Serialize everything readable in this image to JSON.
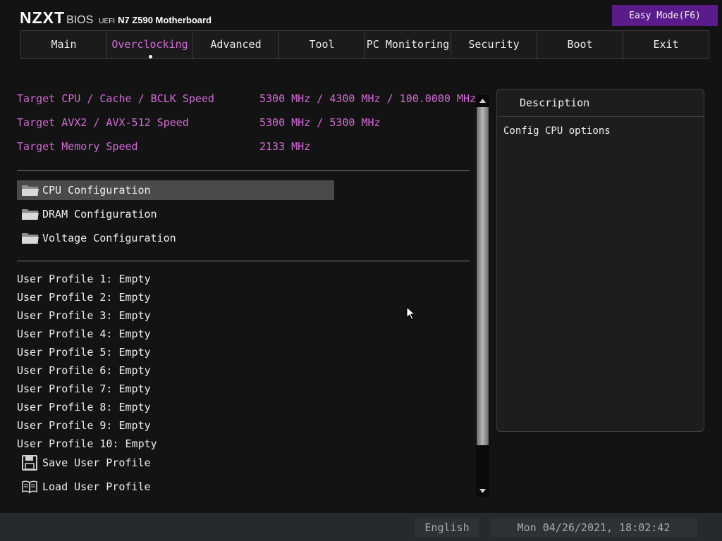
{
  "header": {
    "brand": "NZXT",
    "bios": "BIOS",
    "uefi": "UEFI",
    "model": "N7 Z590 Motherboard",
    "easy_mode_label": "Easy Mode(F6)"
  },
  "tabs": [
    {
      "label": "Main"
    },
    {
      "label": "Overclocking",
      "active": true
    },
    {
      "label": "Advanced"
    },
    {
      "label": "Tool"
    },
    {
      "label": "PC Monitoring"
    },
    {
      "label": "Security"
    },
    {
      "label": "Boot"
    },
    {
      "label": "Exit"
    }
  ],
  "targets": [
    {
      "label": "Target CPU / Cache / BCLK Speed",
      "value": "5300 MHz / 4300 MHz / 100.0000 MHz"
    },
    {
      "label": "Target AVX2 / AVX-512 Speed",
      "value": "5300 MHz / 5300 MHz"
    },
    {
      "label": "Target Memory Speed",
      "value": "2133 MHz"
    }
  ],
  "menus": [
    {
      "label": "CPU Configuration",
      "icon": "folder-icon",
      "selected": true
    },
    {
      "label": "DRAM Configuration",
      "icon": "folder-icon"
    },
    {
      "label": "Voltage Configuration",
      "icon": "folder-icon"
    }
  ],
  "profiles": [
    {
      "label": "User Profile 1: Empty"
    },
    {
      "label": "User Profile 2: Empty"
    },
    {
      "label": "User Profile 3: Empty"
    },
    {
      "label": "User Profile 4: Empty"
    },
    {
      "label": "User Profile 5: Empty"
    },
    {
      "label": "User Profile 6: Empty"
    },
    {
      "label": "User Profile 7: Empty"
    },
    {
      "label": "User Profile 8: Empty"
    },
    {
      "label": "User Profile 9: Empty"
    },
    {
      "label": "User Profile 10: Empty"
    }
  ],
  "actions": {
    "save_label": "Save User Profile",
    "save_icon": "floppy-disk-icon",
    "load_label": "Load User Profile",
    "load_icon": "open-book-icon"
  },
  "description": {
    "title": "Description",
    "text": "Config CPU options"
  },
  "status": {
    "language": "English",
    "datetime": "Mon 04/26/2021, 18:02:42"
  },
  "colors": {
    "accent": "#d36ad6",
    "easy_mode_bg": "#5c1b8a",
    "background": "#131313"
  }
}
